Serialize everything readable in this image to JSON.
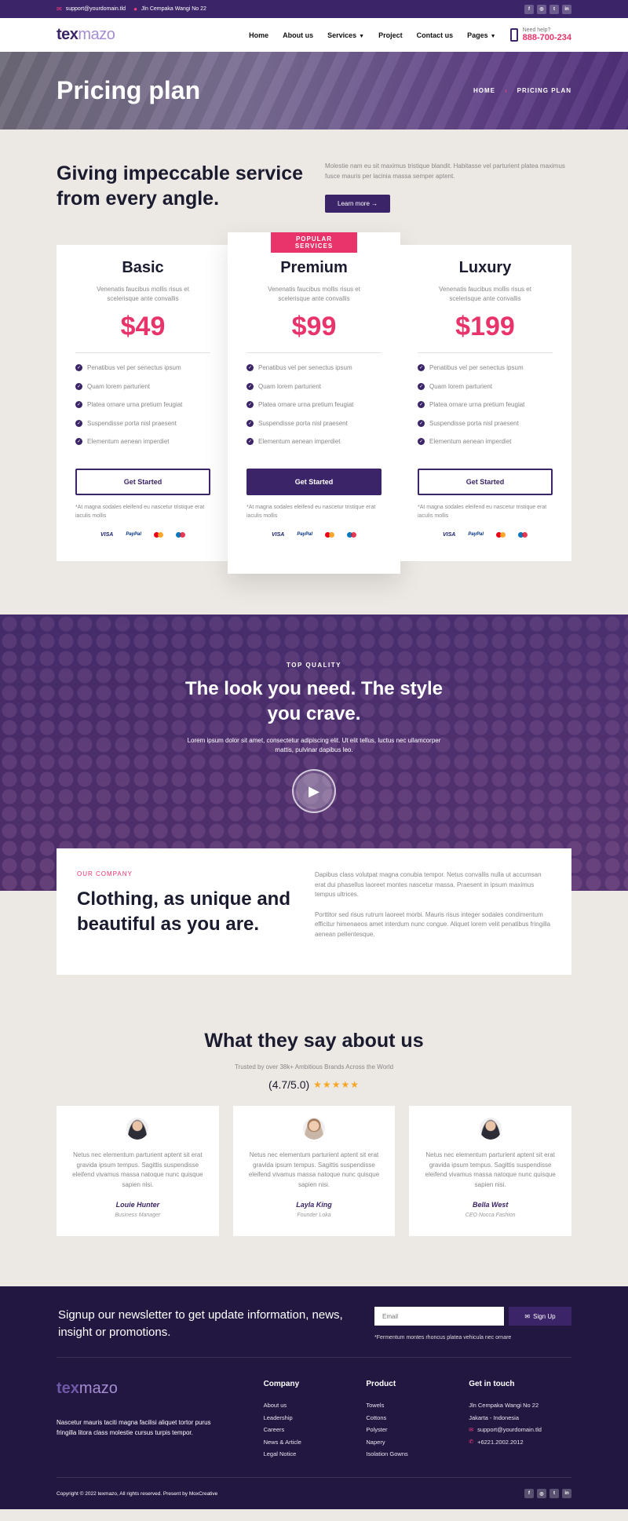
{
  "topbar": {
    "email": "support@yourdomain.tld",
    "address": "Jln Cempaka Wangi No 22",
    "socials": [
      "facebook-icon",
      "instagram-icon",
      "twitter-icon",
      "linkedin-icon"
    ]
  },
  "header": {
    "logo_a": "tex",
    "logo_b": "mazo",
    "nav": [
      "Home",
      "About us",
      "Services",
      "Project",
      "Contact us",
      "Pages"
    ],
    "help_label": "Need help?",
    "help_phone": "888-700-234"
  },
  "pagehead": {
    "title": "Pricing plan",
    "crumb_home": "HOME",
    "crumb_current": "PRICING PLAN"
  },
  "intro": {
    "title": "Giving impeccable service from every angle.",
    "text": "Molestie nam eu sit maximus tristique blandit. Habitasse vel parturient platea maximus fusce mauris per lacinia massa semper aptent.",
    "button": "Learn more →"
  },
  "pricing": {
    "badge": "POPULAR SERVICES",
    "plans": [
      {
        "name": "Basic",
        "desc": "Venenatis faucibus mollis risus et scelerisque ante convallis",
        "price": "$49",
        "features": [
          "Penatibus vel per senectus ipsum",
          "Quam lorem parturient",
          "Platea ornare urna pretium feugiat",
          "Suspendisse porta nisl praesent",
          "Elementum aenean imperdiet"
        ],
        "button": "Get Started",
        "note": "*At magna sodales eleifend eu nascetur tristique erat iaculis mollis"
      },
      {
        "name": "Premium",
        "desc": "Venenatis faucibus mollis risus et scelerisque ante convallis",
        "price": "$99",
        "features": [
          "Penatibus vel per senectus ipsum",
          "Quam lorem parturient",
          "Platea ornare urna pretium feugiat",
          "Suspendisse porta nisl praesent",
          "Elementum aenean imperdiet"
        ],
        "button": "Get Started",
        "note": "*At magna sodales eleifend eu nascetur tristique erat iaculis mollis"
      },
      {
        "name": "Luxury",
        "desc": "Venenatis faucibus mollis risus et scelerisque ante convallis",
        "price": "$199",
        "features": [
          "Penatibus vel per senectus ipsum",
          "Quam lorem parturient",
          "Platea ornare urna pretium feugiat",
          "Suspendisse porta nisl praesent",
          "Elementum aenean imperdiet"
        ],
        "button": "Get Started",
        "note": "*At magna sodales eleifend eu nascetur tristique erat iaculis mollis"
      }
    ],
    "payment_visa": "VISA",
    "payment_paypal": "PayPal"
  },
  "video": {
    "eyebrow": "TOP QUALITY",
    "title": "The look you need. The style you crave.",
    "text": "Lorem ipsum dolor sit amet, consectetur adipiscing elit. Ut elit tellus, luctus nec ullamcorper mattis, pulvinar dapibus leo."
  },
  "company": {
    "tag": "OUR COMPANY",
    "title": "Clothing, as unique and beautiful as you are.",
    "p1": "Dapibus class volutpat magna conubia tempor. Netus convallis nulla ut accumsan erat dui phasellus laoreet montes nascetur massa. Praesent in ipsum maximus tempus ultrices.",
    "p2": "Porttitor sed risus rutrum laoreet morbi. Mauris risus integer sodales condimentum efficitur himenaeos amet interdum nunc congue. Aliquet lorem velit penatibus fringilla aenean pellentesque."
  },
  "testimonials": {
    "title": "What they say about us",
    "subtitle": "Trusted by over 38k+ Ambitious Brands Across the World",
    "rating": "(4.7/5.0)",
    "stars": "★★★★★",
    "items": [
      {
        "quote": "Netus nec elementum parturient aptent sit erat gravida ipsum tempus. Sagittis suspendisse eleifend vivamus massa natoque nunc quisque sapien nisi.",
        "name": "Louie Hunter",
        "role": "Business Manager"
      },
      {
        "quote": "Netus nec elementum parturient aptent sit erat gravida ipsum tempus. Sagittis suspendisse eleifend vivamus massa natoque nunc quisque sapien nisi.",
        "name": "Layla King",
        "role": "Founder Loka"
      },
      {
        "quote": "Netus nec elementum parturient aptent sit erat gravida ipsum tempus. Sagittis suspendisse eleifend vivamus massa natoque nunc quisque sapien nisi.",
        "name": "Bella West",
        "role": "CEO Nocca Fashion"
      }
    ]
  },
  "footer": {
    "newsletter": "Signup our newsletter to get update information, news, insight or promotions.",
    "email_placeholder": "Email",
    "signup": "Sign Up",
    "signup_note": "*Fermentum montes rhoncus platea vehicula nec ornare",
    "about": "Nascetur mauris taciti magna facilisi aliquet tortor purus fringilla litora class molestie cursus turpis tempor.",
    "company_title": "Company",
    "company_links": [
      "About us",
      "Leadership",
      "Careers",
      "News & Article",
      "Legal Notice"
    ],
    "product_title": "Product",
    "product_links": [
      "Towels",
      "Cottons",
      "Polyster",
      "Napery",
      "Isolation Gowns"
    ],
    "contact_title": "Get in touch",
    "contact_address1": "Jln Cempaka Wangi No 22",
    "contact_address2": "Jakarta - Indonesia",
    "contact_email": "support@yourdomain.tld",
    "contact_phone": "+6221.2002.2012",
    "copyright": "Copyright © 2022 texmazo, All rights reserved. Present by MoxCreative"
  },
  "colors": {
    "primary": "#3b2467",
    "accent": "#e8336b",
    "star": "#f5a623",
    "footer_bg": "#211741"
  }
}
